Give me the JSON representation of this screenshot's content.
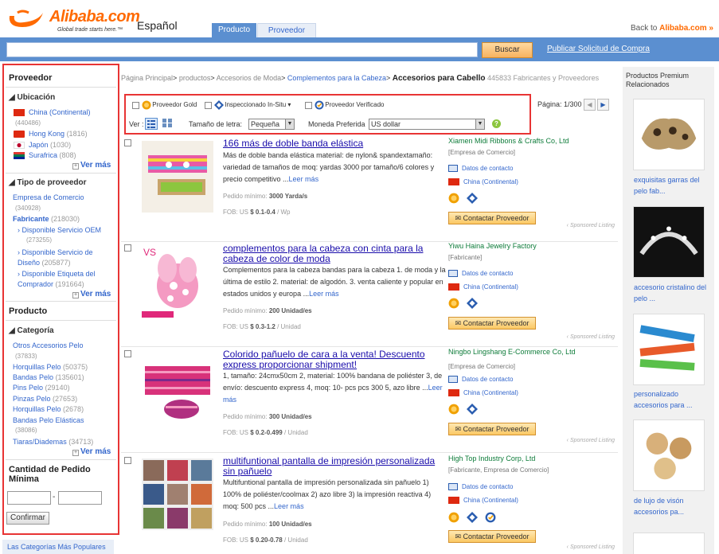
{
  "header": {
    "brand": "Alibaba.com",
    "tagline": "Global trade starts here.™",
    "language": "Español",
    "back_prefix": "Back to ",
    "back_link": "Alibaba.com »",
    "tabs": [
      "Producto",
      "Proveedor"
    ],
    "search_button": "Buscar",
    "post_link": "Publicar Solicitud de Compra"
  },
  "sidebar": {
    "supplier_heading": "Proveedor",
    "location_heading": "Ubicación",
    "locations": [
      {
        "name": "China (Continental)",
        "count": "(440486)"
      },
      {
        "name": "Hong Kong",
        "count": "(1816)"
      },
      {
        "name": "Japón",
        "count": "(1030)"
      },
      {
        "name": "Surafrica",
        "count": "(808)"
      }
    ],
    "more": "Ver más",
    "type_heading": "Tipo de proveedor",
    "types": [
      {
        "name": "Empresa de Comercio",
        "count": "(340928)"
      },
      {
        "name": "Fabricante",
        "count": "(218030)"
      },
      {
        "name": "Disponible Servicio OEM",
        "count": "(273255)"
      },
      {
        "name": "Disponible Servicio de Diseño",
        "count": "(205877)"
      },
      {
        "name": "Disponible Etiqueta del Comprador",
        "count": "(191664)"
      }
    ],
    "product_heading": "Producto",
    "category_heading": "Categoría",
    "categories": [
      {
        "name": "Otros Accesorios Pelo",
        "count": "(37833)"
      },
      {
        "name": "Horquillas Pelo",
        "count": "(50375)"
      },
      {
        "name": "Bandas Pelo",
        "count": "(135601)"
      },
      {
        "name": "Pins Pelo",
        "count": "(29140)"
      },
      {
        "name": "Pinzas Pelo",
        "count": "(27653)"
      },
      {
        "name": "Horquillas Pelo",
        "count": "(2678)"
      },
      {
        "name": "Bandas Pelo Elásticas",
        "count": "(38086)"
      },
      {
        "name": "Tiaras/Diademas",
        "count": "(34713)"
      }
    ],
    "moq_heading": "Cantidad de Pedido Mínima",
    "confirm": "Confirmar",
    "popular": "Las Categorías Más Populares"
  },
  "breadcrumb": {
    "items": [
      "Página Principal",
      "productos",
      "Accesorios de Moda",
      "Complementos para la Cabeza"
    ],
    "current": "Accesorios para Cabello",
    "count": "445833 Fabricantes y Proveedores"
  },
  "filters": {
    "gold": "Proveedor Gold",
    "inspected": "Inspeccionado In-Situ",
    "verified": "Proveedor Verificado",
    "view_label": "Ver :",
    "font_label": "Tamaño de letra:",
    "font_value": "Pequeña",
    "currency_label": "Moneda Preferida",
    "currency_value": "US dollar",
    "pager": "Página: 1/300"
  },
  "products": [
    {
      "title": "166 más de doble banda elástica",
      "desc": "Más de doble banda elástica material: de nylon& spandextamaño: variedad de tamaños de moq: yardas 3000 por tamaño/6 colores y precio competitivo ...",
      "more": "Leer más",
      "moq_label": "Pedido mínimo:",
      "moq_value": "3000 Yarda/s",
      "fob_label": "FOB: US",
      "fob_value": "$ 0.1-0.4",
      "fob_unit": "/ Wp",
      "supplier": "Xiamen Midi Ribbons & Crafts Co, Ltd",
      "supplier_type": "[Empresa de Comercio]",
      "contact": "Datos de contacto",
      "location": "China (Continental)",
      "button": "Contactar Proveedor",
      "sponsored": "‹ Sponsored Listing"
    },
    {
      "title": "complementos para la cabeza con cinta para la cabeza de color de moda",
      "desc": "Complementos para la cabeza bandas para la cabeza 1. de moda y la última de estilo 2. material: de algodón. 3. venta caliente y popular en estados unidos y europa ...",
      "more": "Leer más",
      "moq_label": "Pedido mínimo:",
      "moq_value": "200 Unidad/es",
      "fob_label": "FOB: US",
      "fob_value": "$ 0.3-1.2",
      "fob_unit": "/ Unidad",
      "supplier": "Yiwu Haina Jewelry Factory",
      "supplier_type": "[Fabricante]",
      "contact": "Datos de contacto",
      "location": "China (Continental)",
      "button": "Contactar Proveedor",
      "sponsored": "‹ Sponsored Listing"
    },
    {
      "title": "Colorido pañuelo de cara a la venta! Descuento express proporcionar shipment!",
      "desc": "1, tamaño: 24cmx50cm 2, material: 100% bandana de poliéster 3, de envío: descuento express 4, moq: 10- pcs pcs 300 5, azo libre ...",
      "more": "Leer más",
      "moq_label": "Pedido mínimo:",
      "moq_value": "300 Unidad/es",
      "fob_label": "FOB: US",
      "fob_value": "$ 0.2-0.499",
      "fob_unit": "/ Unidad",
      "supplier": "Ningbo Lingshang E-Commerce Co, Ltd",
      "supplier_type": "[Empresa de Comercio]",
      "contact": "Datos de contacto",
      "location": "China (Continental)",
      "button": "Contactar Proveedor",
      "sponsored": "‹ Sponsored Listing"
    },
    {
      "title": "multifuntional pantalla de impresión personalizada sin pañuelo",
      "desc": "Multifuntional pantalla de impresión personalizada sin pañuelo 1) 100% de poliéster/coolmax 2) azo libre 3) la impresión reactiva 4) moq: 500 pcs ...",
      "more": "Leer más",
      "moq_label": "Pedido mínimo:",
      "moq_value": "100 Unidad/es",
      "fob_label": "FOB: US",
      "fob_value": "$ 0.20-0.78",
      "fob_unit": "/ Unidad",
      "supplier": "High Top Industry Corp, Ltd",
      "supplier_type": "[Fabricante, Empresa de Comercio]",
      "contact": "Datos de contacto",
      "location": "China (Continental)",
      "button": "Contactar Proveedor",
      "sponsored": "‹ Sponsored Listing"
    }
  ],
  "premium": {
    "heading": "Productos Premium Relacionados",
    "items": [
      "exquisitas garras del pelo fab...",
      "accesorio cristalino del pelo ...",
      "personalizado accesorios para ...",
      "de lujo de visón accesorios pa..."
    ]
  },
  "colors": {
    "brand_orange": "#ff6a00",
    "nav_blue": "#5b8fd0",
    "highlight_red": "#e83434",
    "supplier_green": "#0e7c3a"
  }
}
